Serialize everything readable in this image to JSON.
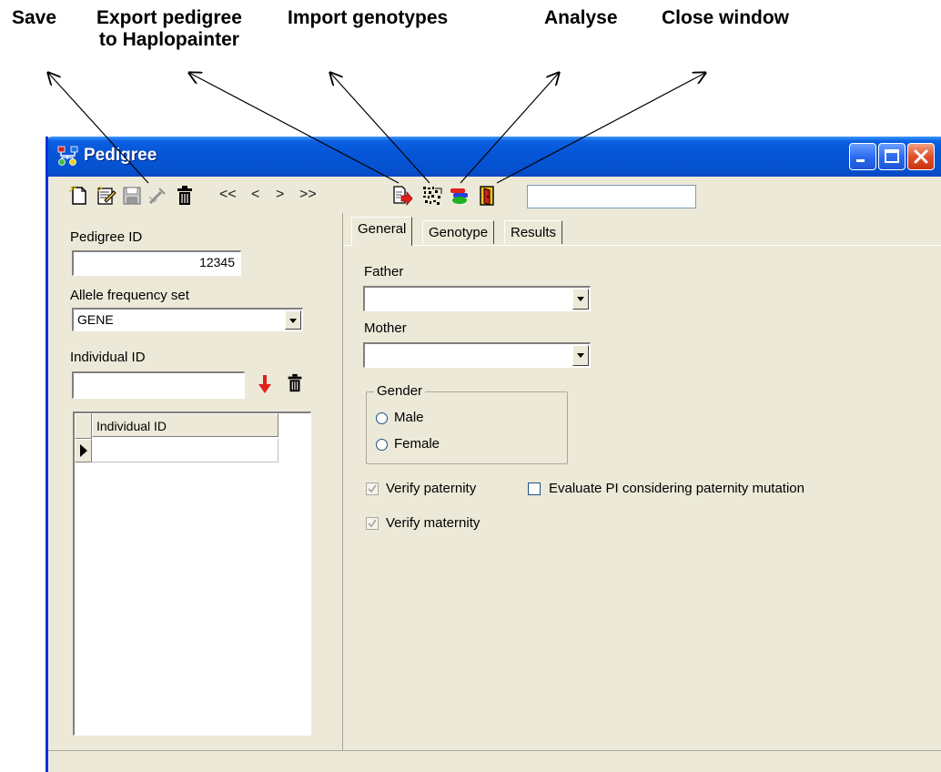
{
  "callouts": {
    "save": "Save",
    "export_line1": "Export pedigree",
    "export_line2": "to Haplopainter",
    "import": "Import genotypes",
    "analyse": "Analyse",
    "close": "Close window"
  },
  "window": {
    "title": "Pedigree"
  },
  "toolbar": {
    "nav": [
      "<<",
      "<",
      ">",
      ">>"
    ],
    "search_value": ""
  },
  "left": {
    "pedigree_id_label": "Pedigree ID",
    "pedigree_id_value": "12345",
    "allele_label": "Allele frequency set",
    "allele_value": "GENE",
    "individual_label": "Individual ID",
    "individual_value": "",
    "grid_header": "Individual ID"
  },
  "tabs": [
    "General",
    "Genotype",
    "Results"
  ],
  "general": {
    "father_label": "Father",
    "father_value": "",
    "mother_label": "Mother",
    "mother_value": "",
    "gender_title": "Gender",
    "male_label": "Male",
    "female_label": "Female",
    "verify_paternity_label": "Verify paternity",
    "verify_paternity_checked": true,
    "evaluate_pi_label": "Evaluate PI considering paternity mutation",
    "evaluate_pi_checked": false,
    "verify_maternity_label": "Verify maternity",
    "verify_maternity_checked": true
  },
  "colors": {
    "titlebar": "#0654d6",
    "window_bg": "#ece9d8",
    "arrow_red": "#e0201a"
  }
}
